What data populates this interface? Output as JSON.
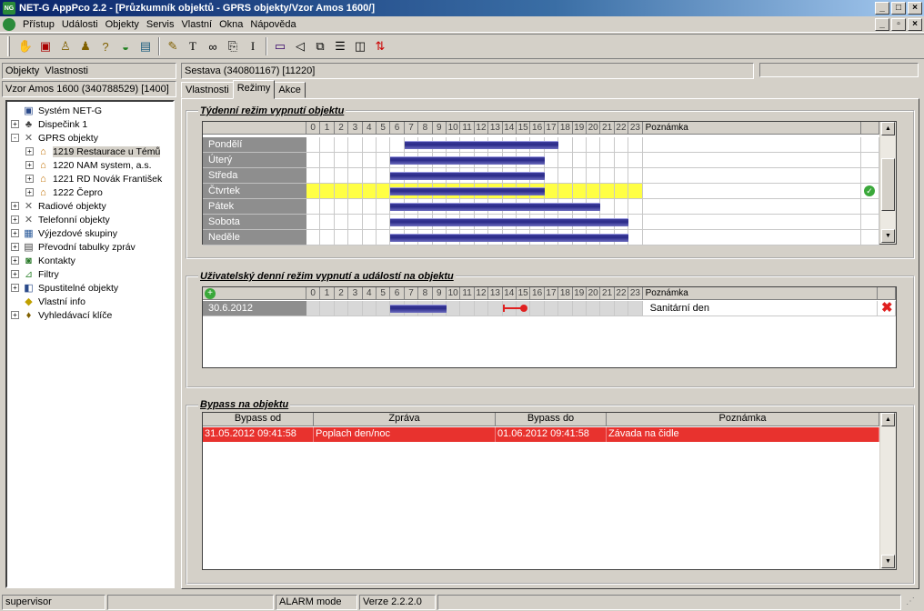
{
  "window": {
    "title": "NET-G AppPco 2.2 - [Průzkumník objektů - GPRS objekty/Vzor Amos 1600/]",
    "app_icon": "NG"
  },
  "menu": [
    "Přístup",
    "Události",
    "Objekty",
    "Servis",
    "Vlastní",
    "Okna",
    "Nápověda"
  ],
  "toolbar_icons": [
    "handshake-icon",
    "monitor-icon",
    "person-icon",
    "persons-icon",
    "person-question-icon",
    "siren-icon",
    "cards-icon",
    "person-edit-icon",
    "text-tool-icon",
    "binoculars-icon",
    "page-arrow-icon",
    "cursor-text-icon",
    "window-icon",
    "speaker-icon",
    "cascade-icon",
    "tile-horizontal-icon",
    "tile-vertical-icon",
    "sort-icon"
  ],
  "left": {
    "header_tabs": [
      "Objekty",
      "Vlastnosti"
    ],
    "path": "Vzor Amos 1600  (340788529) [1400]",
    "tree": [
      {
        "label": "Systém NET-G",
        "level": 0,
        "expand": "",
        "icon": "computer-icon"
      },
      {
        "label": "Dispečink 1",
        "level": 0,
        "expand": "+",
        "icon": "network-icon"
      },
      {
        "label": "GPRS objekty",
        "level": 0,
        "expand": "-",
        "icon": "antenna-icon"
      },
      {
        "label": "1219 Restaurace u Témů",
        "level": 1,
        "expand": "+",
        "icon": "house-icon",
        "selected": true
      },
      {
        "label": "1220 NAM system, a.s.",
        "level": 1,
        "expand": "+",
        "icon": "house-icon"
      },
      {
        "label": "1221 RD Novák František",
        "level": 1,
        "expand": "+",
        "icon": "house-icon"
      },
      {
        "label": "1222 Čepro",
        "level": 1,
        "expand": "+",
        "icon": "house-icon"
      },
      {
        "label": "Radiové objekty",
        "level": 0,
        "expand": "+",
        "icon": "antenna-icon"
      },
      {
        "label": "Telefonní objekty",
        "level": 0,
        "expand": "+",
        "icon": "antenna-icon"
      },
      {
        "label": "Výjezdové skupiny",
        "level": 0,
        "expand": "+",
        "icon": "group-icon"
      },
      {
        "label": "Převodní tabulky zpráv",
        "level": 0,
        "expand": "+",
        "icon": "table-icon"
      },
      {
        "label": "Kontakty",
        "level": 0,
        "expand": "+",
        "icon": "contacts-icon"
      },
      {
        "label": "Filtry",
        "level": 0,
        "expand": "+",
        "icon": "filter-icon"
      },
      {
        "label": "Spustitelné objekty",
        "level": 0,
        "expand": "+",
        "icon": "executable-icon"
      },
      {
        "label": "Vlastní info",
        "level": 0,
        "expand": "",
        "icon": "info-icon"
      },
      {
        "label": "Vyhledávací klíče",
        "level": 0,
        "expand": "+",
        "icon": "keys-icon"
      }
    ]
  },
  "right": {
    "sestava": "Sestava  (340801167) [11220]",
    "tabs": [
      "Vlastnosti",
      "Režimy",
      "Akce"
    ],
    "active_tab": "Režimy"
  },
  "weekly": {
    "title": "Týdenní režim vypnutí objektu",
    "note_header": "Poznámka",
    "hours": [
      "0",
      "1",
      "2",
      "3",
      "4",
      "5",
      "6",
      "7",
      "8",
      "9",
      "10",
      "11",
      "12",
      "13",
      "14",
      "15",
      "16",
      "17",
      "18",
      "19",
      "20",
      "21",
      "22",
      "23"
    ],
    "rows": [
      {
        "day": "Pondělí",
        "bar_start_hour": 7.0,
        "bar_end_hour": 18.0,
        "highlight": false
      },
      {
        "day": "Úterý",
        "bar_start_hour": 6.0,
        "bar_end_hour": 17.0,
        "highlight": false
      },
      {
        "day": "Středa",
        "bar_start_hour": 6.0,
        "bar_end_hour": 17.0,
        "highlight": false
      },
      {
        "day": "Čtvrtek",
        "bar_start_hour": 6.0,
        "bar_end_hour": 17.0,
        "highlight": true,
        "status": "check-icon"
      },
      {
        "day": "Pátek",
        "bar_start_hour": 6.0,
        "bar_end_hour": 21.0,
        "highlight": false
      },
      {
        "day": "Sobota",
        "bar_start_hour": 6.0,
        "bar_end_hour": 23.0,
        "highlight": false
      },
      {
        "day": "Neděle",
        "bar_start_hour": 6.0,
        "bar_end_hour": 23.0,
        "highlight": false
      }
    ]
  },
  "daily": {
    "title": "Uživatelský denní režim vypnutí a událostí na objektu",
    "note_header": "Poznámka",
    "add_icon": "add-icon",
    "rows": [
      {
        "date": "30.6.2012",
        "bar_start_hour": 6.0,
        "bar_end_hour": 10.0,
        "event_start_hour": 14.0,
        "event_end_hour": 15.5,
        "note": "Sanitární den",
        "delete_icon": "delete-icon"
      }
    ]
  },
  "bypass": {
    "title": "Bypass na objektu",
    "columns": [
      "Bypass od",
      "Zpráva",
      "Bypass do",
      "Poznámka"
    ],
    "rows": [
      {
        "from": "31.05.2012 09:41:58",
        "message": "Poplach den/noc",
        "to": "01.06.2012 09:41:58",
        "note": "Závada na čidle"
      }
    ]
  },
  "statusbar": {
    "user": "supervisor",
    "mode": "ALARM mode",
    "version": "Verze 2.2.2.0"
  },
  "colors": {
    "highlight_row": "#ffff44",
    "bypass_row": "#e8322e",
    "bar": "#2a2a88"
  }
}
